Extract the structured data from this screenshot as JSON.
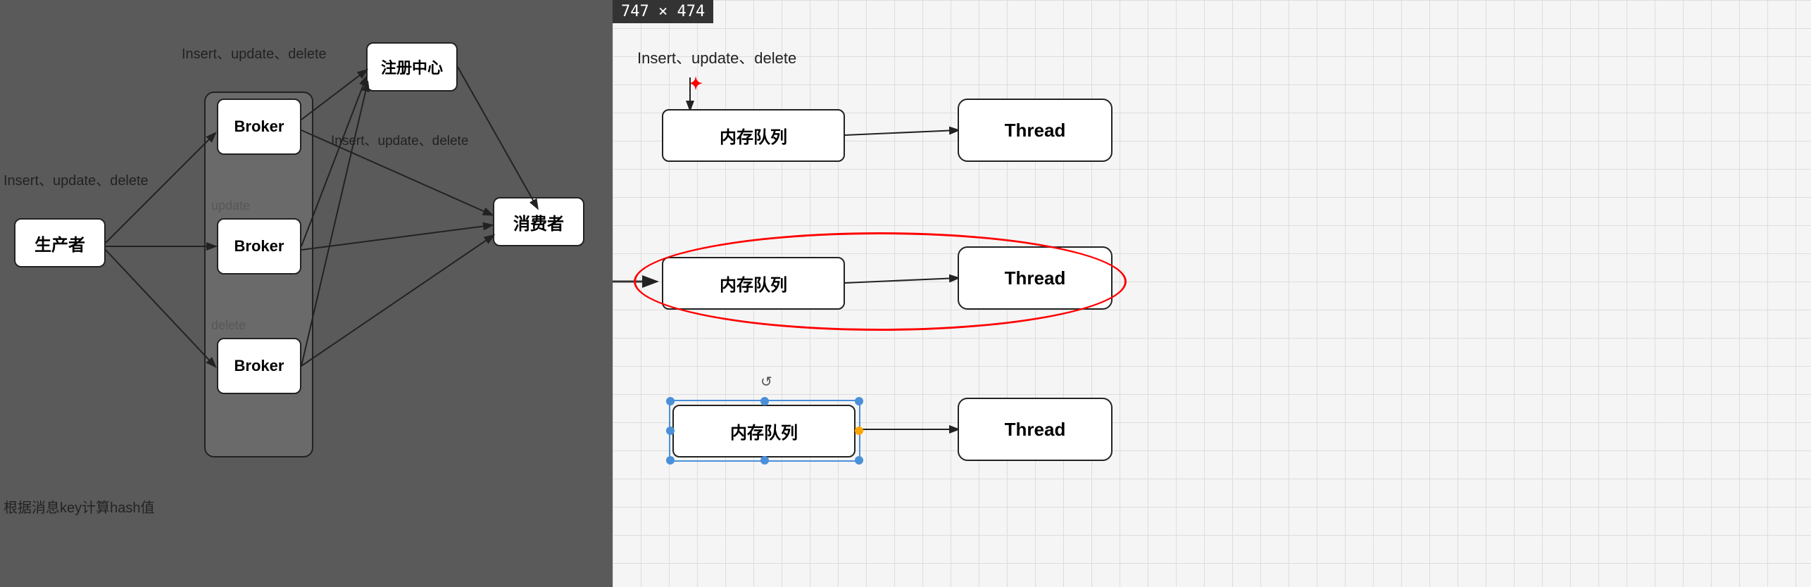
{
  "dimension_badge": "747 × 474",
  "left_panel": {
    "labels": {
      "insert_top": "Insert、update、delete",
      "insert_left": "Insert、update、delete",
      "insert_mid": "Insert、update、delete",
      "update": "update",
      "delete": "delete",
      "hash": "根据消息key计算hash值"
    },
    "boxes": {
      "producer": "生产者",
      "broker1": "Broker",
      "broker2": "Broker",
      "broker3": "Broker",
      "registry": "注册中心",
      "consumer": "消费者"
    }
  },
  "right_panel": {
    "label_insert": "Insert、update、delete",
    "queue_boxes": [
      "内存队列",
      "内存队列",
      "内存队列"
    ],
    "thread_boxes": [
      "Thread",
      "Thread",
      "Thread"
    ]
  }
}
